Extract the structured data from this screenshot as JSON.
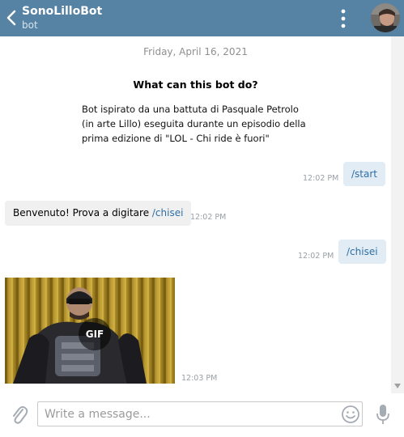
{
  "header": {
    "title": "SonoLilloBot",
    "subtitle": "bot",
    "color": "#5682a3"
  },
  "chat": {
    "date": "Friday, April 16, 2021",
    "intro": {
      "title": "What can this bot do?",
      "lines": [
        "Bot ispirato da una battuta di Pasquale Petrolo",
        "(in arte Lillo) eseguita durante un episodio della",
        "prima edizione di \"LOL - Chi ride è fuori\""
      ]
    },
    "messages": [
      {
        "direction": "outgoing",
        "text": "/start",
        "time": "12:02 PM"
      },
      {
        "direction": "incoming",
        "text": "Benvenuto! Prova a digitare ",
        "command": "/chisei",
        "time": "12:02 PM"
      },
      {
        "direction": "outgoing",
        "text": "/chisei",
        "time": "12:02 PM"
      },
      {
        "direction": "incoming",
        "media": "gif",
        "badge": "GIF",
        "time": "12:03 PM"
      }
    ]
  },
  "composer": {
    "placeholder": "Write a message..."
  },
  "icons": {
    "back": "back-arrow-icon",
    "menu": "more-vertical-icon",
    "attach": "paperclip-icon",
    "emoji": "smiley-icon",
    "mic": "microphone-icon"
  }
}
